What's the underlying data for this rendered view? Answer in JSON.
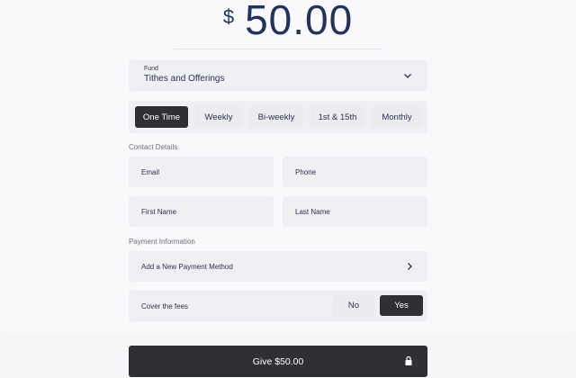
{
  "amount": {
    "currency": "$",
    "value": "50.00"
  },
  "fund": {
    "label": "Fund",
    "value": "Tithes and Offerings"
  },
  "frequency": {
    "options": [
      "One Time",
      "Weekly",
      "Bi-weekly",
      "1st & 15th",
      "Monthly"
    ],
    "selected": "One Time"
  },
  "contact": {
    "heading": "Contact Details",
    "email_label": "Email",
    "phone_label": "Phone",
    "first_name_label": "First Name",
    "last_name_label": "Last Name"
  },
  "payment": {
    "heading": "Payment Information",
    "add_method_label": "Add a New Payment Method"
  },
  "fees": {
    "label": "Cover the fees",
    "no_label": "No",
    "yes_label": "Yes",
    "selected": "Yes"
  },
  "give_button": {
    "label": "Give $50.00"
  },
  "colors": {
    "accent": "#24335d",
    "dark": "#2f3034",
    "field": "#f0eff3"
  },
  "icons": {
    "fund_dropdown": "chevron-down-icon",
    "payment_arrow": "chevron-right-icon",
    "give": "lock-icon"
  }
}
